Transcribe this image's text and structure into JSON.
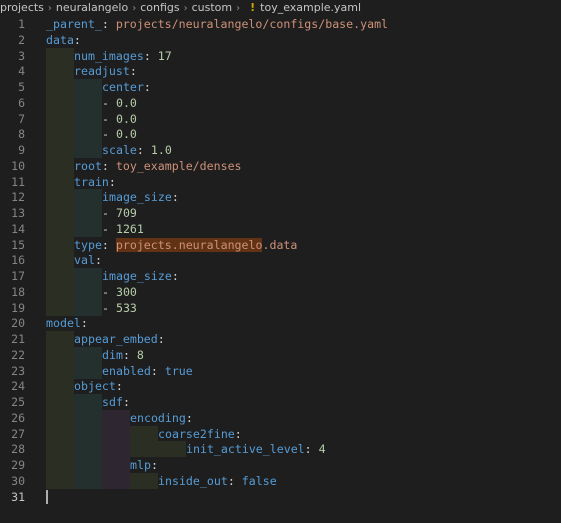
{
  "breadcrumb": [
    "projects",
    "neuralangelo",
    "configs",
    "custom",
    "toy_example.yaml"
  ],
  "breadcrumb_warning_glyph": "!",
  "colors": {
    "key": "#569cd6",
    "string": "#ce9178",
    "number": "#b5cea8",
    "boolean": "#569cd6",
    "punctuation": "#d4d4d4",
    "find_highlight": "#613214"
  },
  "editor": {
    "active_line": 31,
    "lines": [
      {
        "n": "1",
        "indent": 0,
        "tokens": [
          {
            "t": "_parent_",
            "c": "key"
          },
          {
            "t": ": ",
            "c": "p"
          },
          {
            "t": "projects/neuralangelo/configs/base.yaml",
            "c": "str"
          }
        ]
      },
      {
        "n": "2",
        "indent": 0,
        "tokens": [
          {
            "t": "data",
            "c": "key"
          },
          {
            "t": ":",
            "c": "p"
          }
        ]
      },
      {
        "n": "3",
        "indent": 1,
        "tokens": [
          {
            "t": "num_images",
            "c": "key"
          },
          {
            "t": ": ",
            "c": "p"
          },
          {
            "t": "17",
            "c": "num"
          }
        ]
      },
      {
        "n": "4",
        "indent": 1,
        "tokens": [
          {
            "t": "readjust",
            "c": "key"
          },
          {
            "t": ":",
            "c": "p"
          }
        ]
      },
      {
        "n": "5",
        "indent": 2,
        "tokens": [
          {
            "t": "center",
            "c": "key"
          },
          {
            "t": ":",
            "c": "p"
          }
        ]
      },
      {
        "n": "6",
        "indent": 2,
        "tokens": [
          {
            "t": "- ",
            "c": "p"
          },
          {
            "t": "0.0",
            "c": "num"
          }
        ]
      },
      {
        "n": "7",
        "indent": 2,
        "tokens": [
          {
            "t": "- ",
            "c": "p"
          },
          {
            "t": "0.0",
            "c": "num"
          }
        ]
      },
      {
        "n": "8",
        "indent": 2,
        "tokens": [
          {
            "t": "- ",
            "c": "p"
          },
          {
            "t": "0.0",
            "c": "num"
          }
        ]
      },
      {
        "n": "9",
        "indent": 2,
        "tokens": [
          {
            "t": "scale",
            "c": "key"
          },
          {
            "t": ": ",
            "c": "p"
          },
          {
            "t": "1.0",
            "c": "num"
          }
        ]
      },
      {
        "n": "10",
        "indent": 1,
        "tokens": [
          {
            "t": "root",
            "c": "key"
          },
          {
            "t": ": ",
            "c": "p"
          },
          {
            "t": "toy_example/denses",
            "c": "str"
          }
        ]
      },
      {
        "n": "11",
        "indent": 1,
        "tokens": [
          {
            "t": "train",
            "c": "key"
          },
          {
            "t": ":",
            "c": "p"
          }
        ]
      },
      {
        "n": "12",
        "indent": 2,
        "tokens": [
          {
            "t": "image_size",
            "c": "key"
          },
          {
            "t": ":",
            "c": "p"
          }
        ]
      },
      {
        "n": "13",
        "indent": 2,
        "tokens": [
          {
            "t": "- ",
            "c": "p"
          },
          {
            "t": "709",
            "c": "num"
          }
        ]
      },
      {
        "n": "14",
        "indent": 2,
        "tokens": [
          {
            "t": "- ",
            "c": "p"
          },
          {
            "t": "1261",
            "c": "num"
          }
        ]
      },
      {
        "n": "15",
        "indent": 1,
        "tokens": [
          {
            "t": "type",
            "c": "key"
          },
          {
            "t": ": ",
            "c": "p"
          },
          {
            "t": "projects.neuralangelo",
            "c": "str hl"
          },
          {
            "t": ".data",
            "c": "str"
          }
        ]
      },
      {
        "n": "16",
        "indent": 1,
        "tokens": [
          {
            "t": "val",
            "c": "key"
          },
          {
            "t": ":",
            "c": "p"
          }
        ]
      },
      {
        "n": "17",
        "indent": 2,
        "tokens": [
          {
            "t": "image_size",
            "c": "key"
          },
          {
            "t": ":",
            "c": "p"
          }
        ]
      },
      {
        "n": "18",
        "indent": 2,
        "tokens": [
          {
            "t": "- ",
            "c": "p"
          },
          {
            "t": "300",
            "c": "num"
          }
        ]
      },
      {
        "n": "19",
        "indent": 2,
        "tokens": [
          {
            "t": "- ",
            "c": "p"
          },
          {
            "t": "533",
            "c": "num"
          }
        ]
      },
      {
        "n": "20",
        "indent": 0,
        "tokens": [
          {
            "t": "model",
            "c": "key"
          },
          {
            "t": ":",
            "c": "p"
          }
        ]
      },
      {
        "n": "21",
        "indent": 1,
        "tokens": [
          {
            "t": "appear_embed",
            "c": "key"
          },
          {
            "t": ":",
            "c": "p"
          }
        ]
      },
      {
        "n": "22",
        "indent": 2,
        "tokens": [
          {
            "t": "dim",
            "c": "key"
          },
          {
            "t": ": ",
            "c": "p"
          },
          {
            "t": "8",
            "c": "num"
          }
        ]
      },
      {
        "n": "23",
        "indent": 2,
        "tokens": [
          {
            "t": "enabled",
            "c": "key"
          },
          {
            "t": ": ",
            "c": "p"
          },
          {
            "t": "true",
            "c": "bool"
          }
        ]
      },
      {
        "n": "24",
        "indent": 1,
        "tokens": [
          {
            "t": "object",
            "c": "key"
          },
          {
            "t": ":",
            "c": "p"
          }
        ]
      },
      {
        "n": "25",
        "indent": 2,
        "tokens": [
          {
            "t": "sdf",
            "c": "key"
          },
          {
            "t": ":",
            "c": "p"
          }
        ]
      },
      {
        "n": "26",
        "indent": 3,
        "tokens": [
          {
            "t": "encoding",
            "c": "key"
          },
          {
            "t": ":",
            "c": "p"
          }
        ]
      },
      {
        "n": "27",
        "indent": 4,
        "tokens": [
          {
            "t": "coarse2fine",
            "c": "key"
          },
          {
            "t": ":",
            "c": "p"
          }
        ]
      },
      {
        "n": "28",
        "indent": 5,
        "tokens": [
          {
            "t": "init_active_level",
            "c": "key"
          },
          {
            "t": ": ",
            "c": "p"
          },
          {
            "t": "4",
            "c": "num"
          }
        ]
      },
      {
        "n": "29",
        "indent": 3,
        "tokens": [
          {
            "t": "mlp",
            "c": "key"
          },
          {
            "t": ":",
            "c": "p"
          }
        ]
      },
      {
        "n": "30",
        "indent": 4,
        "tokens": [
          {
            "t": "inside_out",
            "c": "key"
          },
          {
            "t": ": ",
            "c": "p"
          },
          {
            "t": "false",
            "c": "bool"
          }
        ]
      },
      {
        "n": "31",
        "indent": 0,
        "tokens": []
      }
    ]
  }
}
